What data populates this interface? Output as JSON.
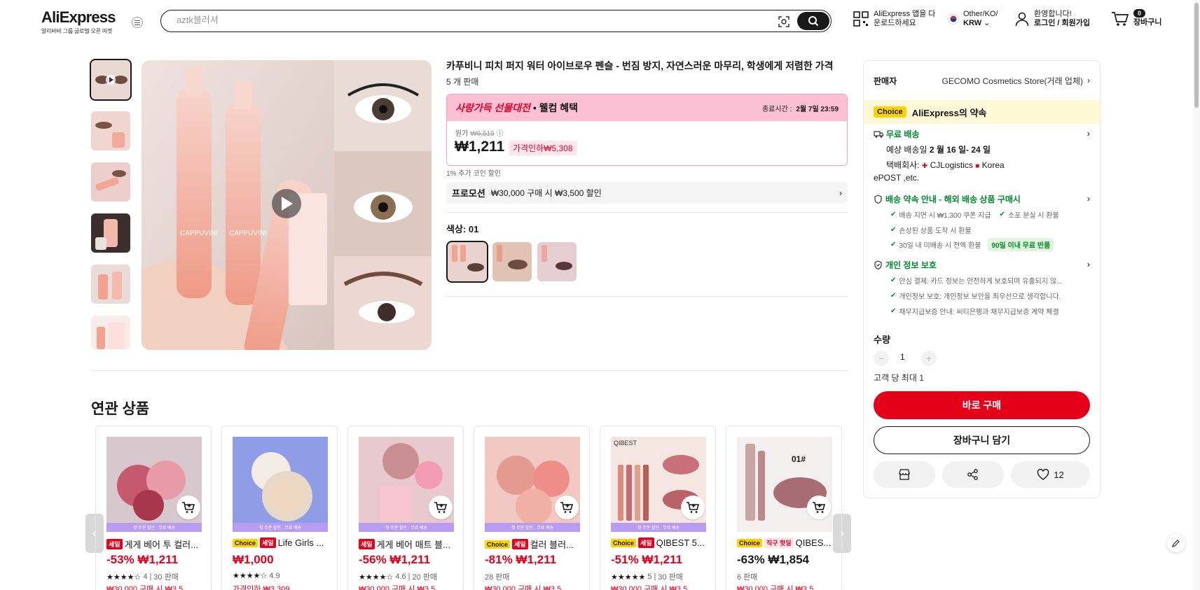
{
  "header": {
    "brand": "AliExpress",
    "tagline": "알리바바 그룹 글로벌 오픈 마켓",
    "search_placeholder": "aztk블러셔",
    "app_line1": "AliExpress 앱을 다",
    "app_line2": "운로드하세요",
    "region_line1": "Other/KO/",
    "region_line2": "KRW",
    "user_line1": "환영합니다!",
    "user_line2": "로그인 / 회원가입",
    "cart_count": "0",
    "cart_label": "장바구니"
  },
  "product": {
    "title": "카푸비니 피치 퍼지 워터 아이브로우 펜슬 - 번짐 방지, 자연스러운 마무리, 학생에게 저렴한 가격",
    "sold": "5 개 판매",
    "promo_title_a": "사랑가득 선물대전",
    "promo_title_b": " • 웰컴 혜택",
    "promo_end_label": "종료시간 :",
    "promo_end_value": "2월 7일 23:59",
    "orig_label": "원가",
    "orig_price": "₩6,519",
    "price": "₩1,211",
    "discount": "가격인하₩5,308",
    "coin": "1% 추가 코인 할인",
    "promotion_label": "프로모션",
    "promotion_text": "₩30,000 구매 시 ₩3,500 할인",
    "color_label": "색상: 01"
  },
  "panel": {
    "seller_label": "판매자",
    "seller_name": "GECOMO Cosmetics Store(거래 업체)",
    "choice_tag": "Choice",
    "choice_text": "AliExpress의 약속",
    "free_ship": "무료 배송",
    "est_delivery": "예상 배송일",
    "est_date": "2 월 16 일- 24 일",
    "carrier_label": "택배회사:",
    "carrier1": "CJLogistics",
    "carrier2": "Korea",
    "carrier3": "ePOST ,etc.",
    "guarantee_title": "배송 약속 안내 - 해외 배송 상품 구매시",
    "guarantee_items": [
      "배송 지연 시 ₩1,300 쿠폰 지급",
      "소포 분실 시 환불",
      "손상된 상품 도착 시 환불",
      "30일 내 미배송 시 전액 환불"
    ],
    "return_tag": "90일 이내 무료 반품",
    "privacy_title": "개인 정보 보호",
    "privacy_items": [
      "안심 결제: 카드 정보는 안전하게 보호되며 유출되지 않...",
      "개인정보 보호: 개인정보 보안을 최우선으로 생각합니다.",
      "채무지급보증 안내: 씨티은행과 채무지급보증 계약 체결"
    ],
    "qty_label": "수량",
    "qty_minus": "−",
    "qty_value": "1",
    "qty_plus": "+",
    "limit": "고객 당 최대 1",
    "buy_now": "바로 구매",
    "add_cart": "장바구니 담기",
    "wish_count": "12"
  },
  "related": {
    "title": "연관 상품",
    "strip_text": "첫 주문 할인 · 무료 배송",
    "prev": "‹",
    "next": "›",
    "items": [
      {
        "tags": [
          "세일"
        ],
        "name": "게게 베어 투 컬러...",
        "price": "-53% ₩1,211",
        "stars": "★★★★☆",
        "rating": "4",
        "sold": "30 판매",
        "extra": "₩30,000 구매 시 ₩3,5"
      },
      {
        "tags": [
          "Choice",
          "세일"
        ],
        "name": "Life Girls ...",
        "price": "₩1,000",
        "stars": "★★★★☆",
        "rating": "4.9",
        "sold": "",
        "extra": "가격인하 ₩3,309"
      },
      {
        "tags": [
          "세일"
        ],
        "name": "게게 베어 매트 블...",
        "price": "-56% ₩1,211",
        "stars": "★★★★☆",
        "rating": "4.6",
        "sold": "20 판매",
        "extra": "₩30,000 구매 시 ₩3,5"
      },
      {
        "tags": [
          "Choice",
          "세일"
        ],
        "name": "컬러 블러...",
        "price": "-81% ₩1,211",
        "stars": "",
        "rating": "",
        "sold": "28 판매",
        "extra": "₩30,000 구매 시 ₩3,5"
      },
      {
        "tags": [
          "Choice",
          "세일"
        ],
        "name": "QIBEST 5...",
        "price": "-51% ₩1,211",
        "stars": "★★★★★",
        "rating": "5",
        "sold": "30 판매",
        "extra": "₩30,000 구매 시 ₩3,5"
      },
      {
        "tags": [
          "Choice",
          "직구 핫딜"
        ],
        "name": "QIBES...",
        "price": "-63% ₩1,854",
        "stars": "",
        "rating": "",
        "sold": "6 판매",
        "extra": "₩30,000 구매 시 ₩3,5"
      }
    ]
  },
  "colors": {
    "accent": "#e50019",
    "choice": "#ffd200",
    "promo_pink": "#fbc0d3",
    "green": "#008a2e"
  }
}
